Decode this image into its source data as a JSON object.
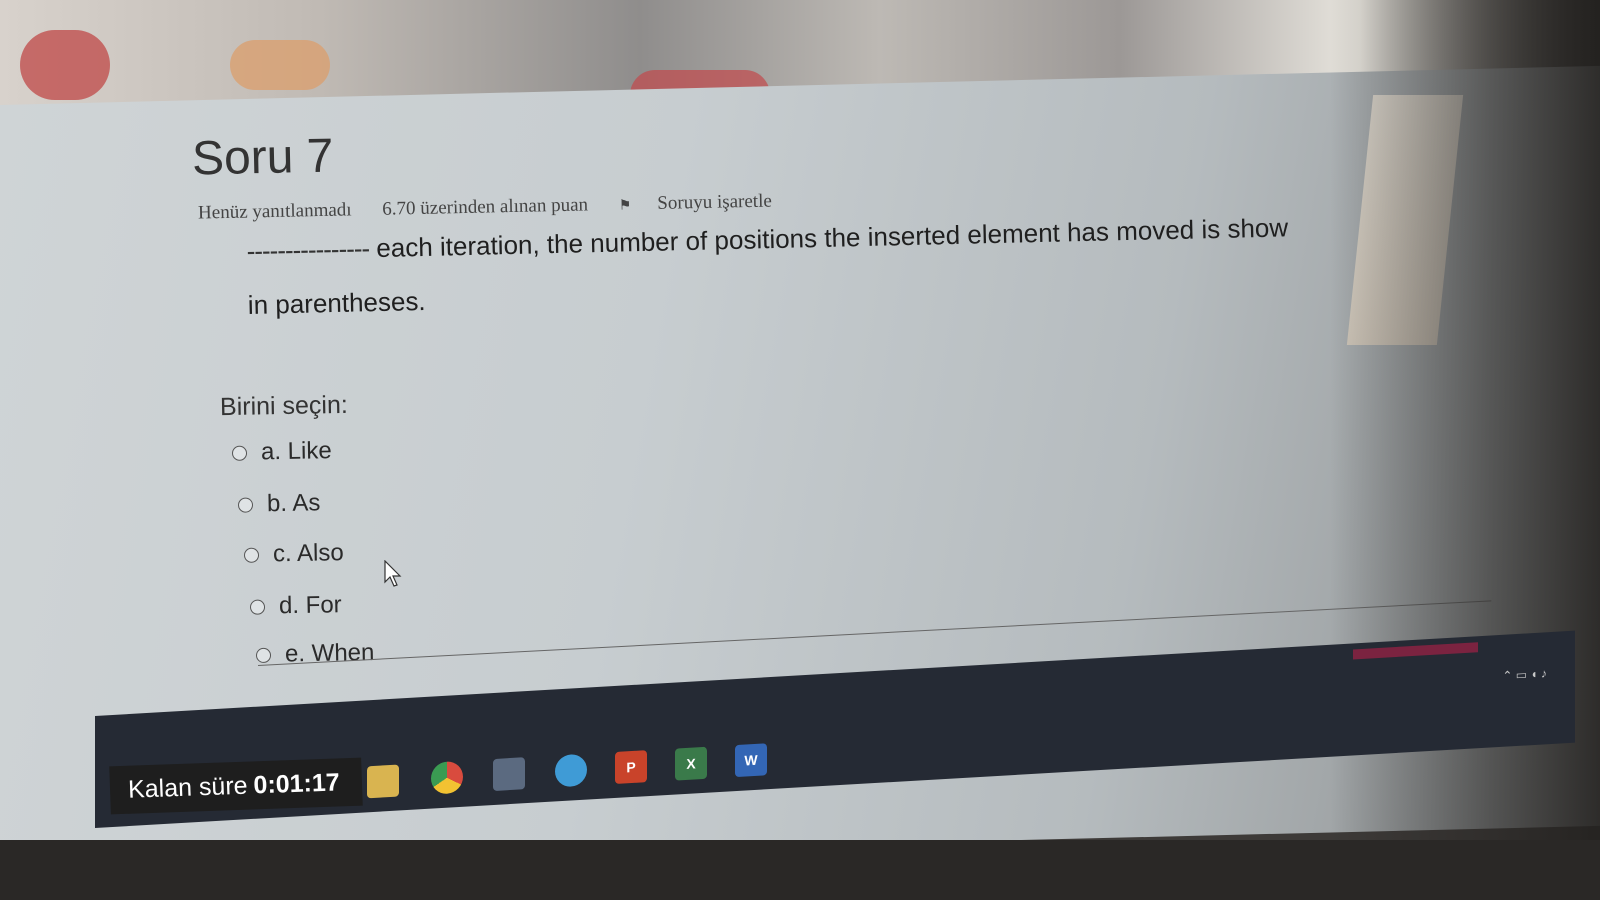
{
  "question": {
    "title": "Soru 7",
    "status": "Henüz yanıtlanmadı",
    "points": "6.70 üzerinden alınan puan",
    "flag_label": "Soruyu işaretle",
    "blank": "----------------",
    "text_line1": "each iteration, the number of positions the inserted element has moved is show",
    "text_line2": "in parentheses."
  },
  "prompt": "Birini seçin:",
  "options": [
    {
      "label": "a. Like"
    },
    {
      "label": "b. As"
    },
    {
      "label": "c. Also"
    },
    {
      "label": "d. For"
    },
    {
      "label": "e. When"
    }
  ],
  "timer": {
    "label": "Kalan süre",
    "value": "0:01:17"
  },
  "taskbar": {
    "icons": [
      "windows-start-icon",
      "search-icon",
      "task-view-icon",
      "edge-icon",
      "file-explorer-icon",
      "chrome-icon",
      "store-icon",
      "telegram-icon",
      "powerpoint-icon",
      "excel-icon",
      "word-icon"
    ],
    "ppt": "P",
    "xls": "X",
    "doc": "W"
  }
}
